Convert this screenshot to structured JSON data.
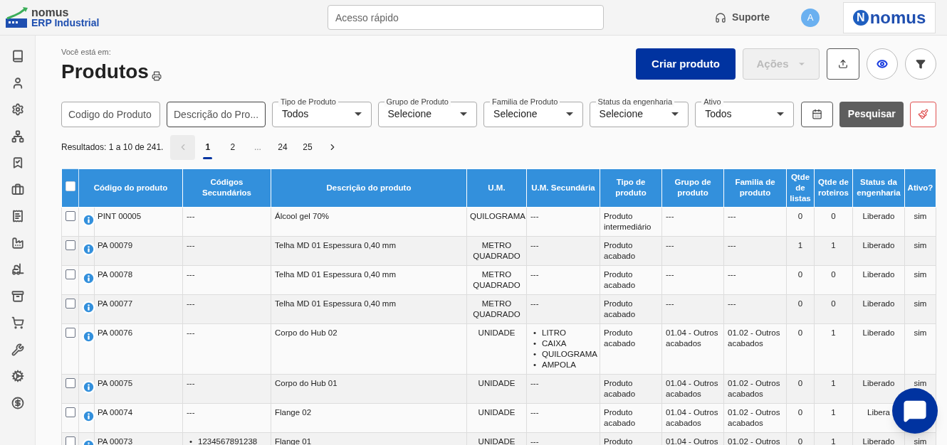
{
  "header": {
    "logo": {
      "brand": "nomus",
      "product": "ERP Industrial"
    },
    "search": {
      "placeholder": "Acesso rápido"
    },
    "support": "Suporte",
    "avatar": "A",
    "brand_logo": {
      "letter": "N",
      "text": "nomus"
    }
  },
  "breadcrumb": "Você está em:",
  "title": "Produtos",
  "actions": {
    "create": "Criar produto",
    "more": {
      "label": "Ações",
      "disabled": true
    }
  },
  "filters": [
    {
      "kind": "text",
      "placeholder": "Codigo do Produto"
    },
    {
      "kind": "text",
      "placeholder": "Descrição do Pro..."
    },
    {
      "kind": "select",
      "label": "Tipo de Produto",
      "value": "Todos"
    },
    {
      "kind": "select",
      "label": "Grupo de Produto",
      "value": "Selecione"
    },
    {
      "kind": "select",
      "label": "Familia de Produto",
      "value": "Selecione"
    },
    {
      "kind": "select",
      "label": "Status da engenharia",
      "value": "Selecione"
    },
    {
      "kind": "select",
      "label": "Ativo",
      "value": "Todos"
    }
  ],
  "search_button": "Pesquisar",
  "results": "Resultados: 1 a 10 de 241.",
  "pagination": [
    {
      "kind": "prev",
      "disabled": true
    },
    {
      "kind": "page",
      "label": "1",
      "selected": true
    },
    {
      "kind": "page",
      "label": "2",
      "selected": false
    },
    {
      "kind": "gap",
      "label": "..."
    },
    {
      "kind": "page",
      "label": "24",
      "selected": false
    },
    {
      "kind": "page",
      "label": "25",
      "selected": false
    },
    {
      "kind": "next",
      "disabled": false
    }
  ],
  "table": {
    "select_all_checked": false,
    "list_marker": "•",
    "columns": [
      "Código do produto",
      "Códigos Secundários",
      "Descrição do produto",
      "U.M.",
      "U.M. Secundária",
      "Tipo de produto",
      "Grupo de produto",
      "Familia de produto",
      "Qtde de listas",
      "Qtde de roteiros",
      "Status da engenharia",
      "Ativo?"
    ],
    "rows": [
      {
        "checked": false,
        "code": "PINT 00005",
        "secondary_codes": "---",
        "description": "Álcool gel 70%",
        "um": "QUILOGRAMA",
        "um_secondary": "---",
        "type": "Produto intermediário",
        "group": "---",
        "family": "---",
        "lists": "0",
        "routes": "0",
        "status": "Liberado",
        "active": "sim"
      },
      {
        "checked": false,
        "code": "PA 00079",
        "secondary_codes": "---",
        "description": "Telha MD 01 Espessura 0,40 mm",
        "um": "METRO QUADRADO",
        "um_secondary": "---",
        "type": "Produto acabado",
        "group": "---",
        "family": "---",
        "lists": "1",
        "routes": "1",
        "status": "Liberado",
        "active": "sim"
      },
      {
        "checked": false,
        "code": "PA 00078",
        "secondary_codes": "---",
        "description": "Telha MD 01 Espessura 0,40 mm",
        "um": "METRO QUADRADO",
        "um_secondary": "---",
        "type": "Produto acabado",
        "group": "---",
        "family": "---",
        "lists": "0",
        "routes": "0",
        "status": "Liberado",
        "active": "sim"
      },
      {
        "checked": false,
        "code": "PA 00077",
        "secondary_codes": "---",
        "description": "Telha MD 01 Espessura 0,40 mm",
        "um": "METRO QUADRADO",
        "um_secondary": "---",
        "type": "Produto acabado",
        "group": "---",
        "family": "---",
        "lists": "0",
        "routes": "0",
        "status": "Liberado",
        "active": "sim"
      },
      {
        "checked": false,
        "code": "PA 00076",
        "secondary_codes": "---",
        "description": "Corpo do Hub 02",
        "um": "UNIDADE",
        "um_secondary": [
          "LITRO",
          "CAIXA",
          "QUILOGRAMA",
          "AMPOLA"
        ],
        "type": "Produto acabado",
        "group": "01.04 - Outros acabados",
        "family": "01.02 - Outros acabados",
        "lists": "0",
        "routes": "1",
        "status": "Liberado",
        "active": "sim"
      },
      {
        "checked": false,
        "code": "PA 00075",
        "secondary_codes": "---",
        "description": "Corpo do Hub 01",
        "um": "UNIDADE",
        "um_secondary": "---",
        "type": "Produto acabado",
        "group": "01.04 - Outros acabados",
        "family": "01.02 - Outros acabados",
        "lists": "0",
        "routes": "1",
        "status": "Liberado",
        "active": "sim"
      },
      {
        "checked": false,
        "code": "PA 00074",
        "secondary_codes": "---",
        "description": "Flange 02",
        "um": "UNIDADE",
        "um_secondary": "---",
        "type": "Produto acabado",
        "group": "01.04 - Outros acabados",
        "family": "01.02 - Outros acabados",
        "lists": "0",
        "routes": "1",
        "status": "Libera"
      },
      {
        "checked": false,
        "code": "PA 00073",
        "secondary_codes": [
          "1234567891238"
        ],
        "description": "Flange 01",
        "um": "UNIDADE",
        "um_secondary": "---",
        "type": "Produto",
        "group": "01.04 - Outros",
        "family": "01.02 - Outros",
        "lists": "0",
        "routes": "1",
        "status": "Liberado",
        "active": "sim"
      }
    ]
  }
}
